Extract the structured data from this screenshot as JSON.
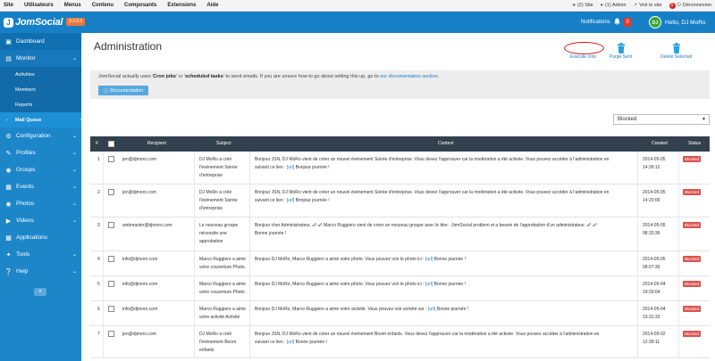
{
  "topbar": {
    "menu": [
      "Site",
      "Utilisateurs",
      "Menus",
      "Contenu",
      "Composants",
      "Extensions",
      "Aide"
    ],
    "site_count": "(2) Site",
    "admin_count": "(1) Admin",
    "view_site": "Voir le site",
    "logout_badge": "0",
    "logout": "Déconnexion"
  },
  "header": {
    "logo": "JomSocial",
    "logo_mark": "J",
    "version": "3.2.0.5",
    "notifications_label": "Notifications",
    "notifications_count": "0",
    "avatar_initials": "DJ",
    "greeting": "Hello, DJ MoRo"
  },
  "sidebar": {
    "dashboard": "Dashboard",
    "monitor": "Monitor",
    "monitor_items": [
      "Activities",
      "Members",
      "Reports",
      "Mail Queue"
    ],
    "items": [
      "Configuration",
      "Profiles",
      "Groups",
      "Events",
      "Photos",
      "Videos",
      "Applications",
      "Tools",
      "Help"
    ],
    "collapse": "«"
  },
  "main": {
    "title": "Administration",
    "execute_cron": "Execute cron",
    "purge_sent": "Purge Sent",
    "delete_selected": "Delete Selected",
    "info_pre": "JomSocial actually uses '",
    "info_b1": "Cron jobs",
    "info_mid": "' or '",
    "info_b2": "scheduled tasks",
    "info_post": "' to send emails. If you are unsure how to go about setting this up, go to ",
    "info_link": "our documentation section",
    "info_end": ".",
    "doc_button": "Documentation",
    "filter_value": "Blocked"
  },
  "table": {
    "headers": {
      "num": "#",
      "recipient": "Recipient",
      "subject": "Subject",
      "content": "Content",
      "created": "Created",
      "status": "Status"
    },
    "rows": [
      {
        "num": "1",
        "recipient": "jen@djmoro.com",
        "subject": [
          "DJ MoRo a créé",
          "l'évènement Soirée",
          "d'entreprise"
        ],
        "content": [
          "Bonjour JSN, DJ MoRo vient de créer un nouvel évènement Soirée d'entreprise. Vous devez l'approuver car la modération a été activée. Vous pouvez accéder à l'administration en",
          "suivant ce lien : [url] Bonjour journée !"
        ],
        "created": [
          "2014-05-05",
          "14:39:12"
        ],
        "status": "Blocked"
      },
      {
        "num": "2",
        "recipient": "jen@djmoro.com",
        "subject": [
          "DJ MoRo a créé",
          "l'évènement Soirée",
          "d'entreprise"
        ],
        "content": [
          "Bonjour JSN, DJ MoRo vient de créer un nouvel évènement Soirée d'entreprise. Vous devez l'approuver car la modération a été activée. Vous pouvez accéder à l'administration en",
          "suivant ce lien : [url] Bonjour journée !"
        ],
        "created": [
          "2014-05-05",
          "14:20:00"
        ],
        "status": "Blocked"
      },
      {
        "num": "3",
        "recipient": "webmaster@djmoro.com",
        "subject": [
          "Le nouveau groupe",
          "nécessite une",
          "approbation"
        ],
        "content": [
          "Bonjour cher Administrateur, ☍ ☍ Marco Ruggiero vient de créer un nouveau groupe avec le titre : JomSocial problem et a besoin de l'approbation d'un administrateur. ☍ ☍",
          "Bonne journée !"
        ],
        "created": [
          "2014-05-05",
          "08:33:36"
        ],
        "status": "Blocked"
      },
      {
        "num": "4",
        "recipient": "info@djmoro.com",
        "subject": [
          "Marco Ruggiero a aimé",
          "votre couverture Photo."
        ],
        "content": [
          "Bonjour DJ MoRo, Marco Ruggiero a aimé votre photo. Vous pouvez voir le photo ici : [url] Bonne journée !"
        ],
        "created": [
          "2014-05-05",
          "08:07:30"
        ],
        "status": "Blocked"
      },
      {
        "num": "5",
        "recipient": "info@djmoro.com",
        "subject": [
          "Marco Ruggiero a aimé",
          "votre couverture Photo."
        ],
        "content": [
          "Bonjour DJ MoRo, Marco Ruggiero a aimé votre photo. Vous pouvez voir le photo ici : [url] Bonne journée !"
        ],
        "created": [
          "2014-05-04",
          "19:33:04"
        ],
        "status": "Blocked"
      },
      {
        "num": "6",
        "recipient": "info@djmoro.com",
        "subject": [
          "Marco Ruggiero a aimé",
          "votre activité Activité"
        ],
        "content": [
          "Bonjour DJ MoRo, Marco Ruggiero a aimé votre activité. Vous pouvez voir activité sur : [url] Bonne journée !"
        ],
        "created": [
          "2014-05-04",
          "19:31:33"
        ],
        "status": "Blocked"
      },
      {
        "num": "7",
        "recipient": "jen@djmoro.com",
        "subject": [
          "DJ MoRo a créé",
          "l'évènement Boom",
          "enfants"
        ],
        "content": [
          "Bonjour JSN, DJ MoRo vient de créer un nouvel évènement Boom enfants. Vous devez l'approuver car la modération a été activée. Vous pouvez accéder à l'administration en",
          "suivant ce lien : [url] Bonne journée !"
        ],
        "created": [
          "2014-05-02",
          "12:39:11"
        ],
        "status": "Blocked"
      }
    ]
  }
}
